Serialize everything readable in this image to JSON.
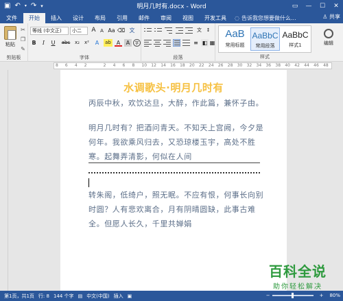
{
  "window": {
    "title": "明月几时有.docx - Word",
    "share": "共享"
  },
  "tabs": {
    "file": "文件",
    "items": [
      "开始",
      "插入",
      "设计",
      "布局",
      "引用",
      "邮件",
      "审阅",
      "视图",
      "开发工具"
    ],
    "active_index": 0,
    "tellme": "告诉我您想要做什么..."
  },
  "ribbon": {
    "clipboard": {
      "paste": "粘贴",
      "label": "剪贴板"
    },
    "font": {
      "family": "等线 (中文正)",
      "size": "小二",
      "label": "字体",
      "grow": "A",
      "shrink": "A",
      "bold": "B",
      "italic": "I",
      "underline": "U",
      "strike": "abc",
      "sub": "x₂",
      "sup": "x²",
      "effects": "A",
      "highlight": "ab",
      "color": "A",
      "shade": "A",
      "circle": "字"
    },
    "paragraph": {
      "label": "段落"
    },
    "styles": {
      "label": "样式",
      "items": [
        {
          "sample": "AaB",
          "name": "常用标题"
        },
        {
          "sample": "AaBbC",
          "name": "常用段落"
        },
        {
          "sample": "AaBbC",
          "name": "样式1"
        }
      ]
    },
    "editing": {
      "label": "编辑"
    }
  },
  "ruler": {
    "ticks": [
      "8",
      "6",
      "4",
      "2",
      "",
      "2",
      "4",
      "6",
      "8",
      "10",
      "12",
      "14",
      "16",
      "18",
      "20",
      "22",
      "24",
      "26",
      "28",
      "30",
      "32",
      "34",
      "36",
      "38",
      "40",
      "42",
      "44",
      "46",
      "48"
    ]
  },
  "document": {
    "title": "水调歌头·明月几时有",
    "paragraphs": [
      "丙辰中秋，欢饮达旦，大醉，作此篇，兼怀子由。",
      "明月几时有？把酒问青天。不知天上宫阙，今夕是何年。我欲乘风归去，又恐琼楼玉宇，高处不胜寒。起舞弄清影，何似在人间",
      "转朱阁，低绮户，照无眠。不应有恨，何事长向别时圆？人有悲欢离合，月有阴晴圆缺，此事古难全。但愿人长久，千里共婵娟"
    ]
  },
  "status": {
    "page": "第1页，共1页",
    "row": "行: 8",
    "words": "144 个字",
    "lang": "中文(中国)",
    "mode": "插入",
    "zoom": "80%"
  },
  "watermark": {
    "big": "百科全说",
    "small": "助你轻松解决"
  }
}
